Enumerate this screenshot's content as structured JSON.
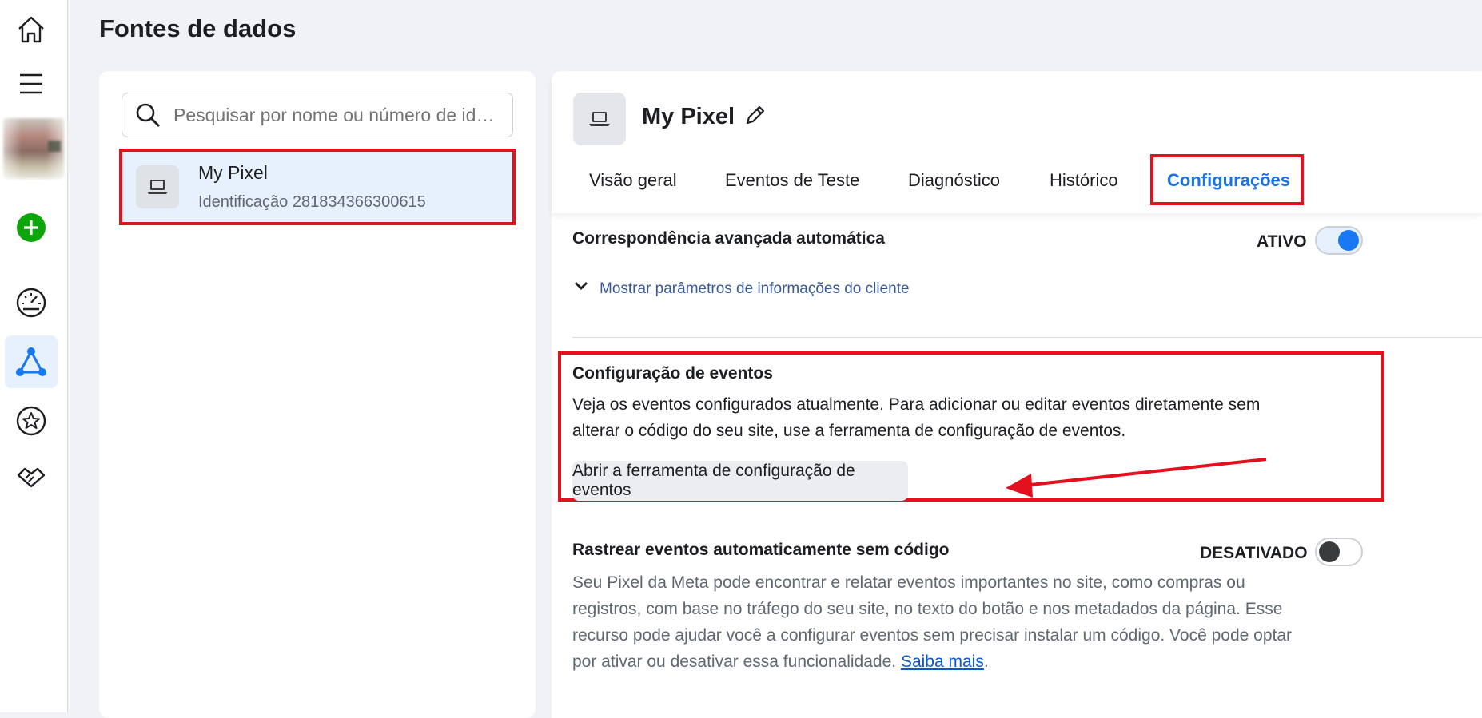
{
  "page": {
    "title": "Fontes de dados"
  },
  "search": {
    "placeholder": "Pesquisar por nome ou número de id…"
  },
  "list": {
    "items": [
      {
        "name": "My Pixel",
        "id_text": "Identificação 281834366300615"
      }
    ]
  },
  "detail": {
    "title": "My Pixel",
    "tabs": [
      "Visão geral",
      "Eventos de Teste",
      "Diagnóstico",
      "Histórico",
      "Configurações"
    ],
    "active_tab": "Configurações",
    "advanced_matching": {
      "title": "Correspondência avançada automática",
      "status": "ATIVO",
      "enabled": true,
      "link": "Mostrar parâmetros de informações do cliente"
    },
    "event_setup": {
      "title": "Configuração de eventos",
      "line1": "Veja os eventos configurados atualmente. Para adicionar ou editar eventos diretamente sem",
      "line2": "alterar o código do seu site, use a ferramenta de configuração de eventos.",
      "button": "Abrir a ferramenta de configuração de eventos"
    },
    "auto_tracking": {
      "title": "Rastrear eventos automaticamente sem código",
      "status": "DESATIVADO",
      "enabled": false,
      "line1": "Seu Pixel da Meta pode encontrar e relatar eventos importantes no site, como compras ou",
      "line2": "registros, com base no tráfego do seu site, no texto do botão e nos metadados da página. Esse",
      "line3": "recurso pode ajudar você a configurar eventos sem precisar instalar um código. Você pode optar",
      "line4": "por ativar ou desativar essa funcionalidade.",
      "learn_more": "Saiba mais",
      "period": "."
    }
  },
  "colors": {
    "accent": "#1877f2",
    "annotation": "#e3101d",
    "add": "#0ca60c"
  },
  "icons": [
    "home-icon",
    "menu-icon",
    "add-icon",
    "speedometer-icon",
    "events-manager-icon",
    "star-icon",
    "handshake-icon",
    "search-icon",
    "laptop-icon",
    "pencil-icon",
    "chevron-down-icon"
  ]
}
